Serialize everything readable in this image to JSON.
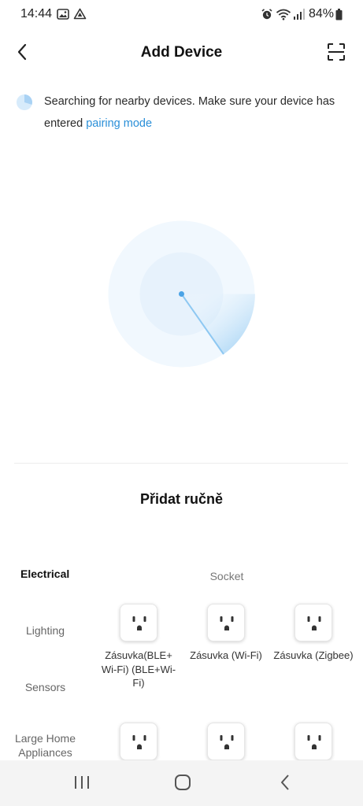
{
  "status_bar": {
    "time": "14:44",
    "battery": "84%",
    "left_icons": [
      "image-icon",
      "drive-icon"
    ],
    "right_icons": [
      "alarm-icon",
      "wifi-icon",
      "signal-icon",
      "battery-icon"
    ]
  },
  "header": {
    "title": "Add Device",
    "back_icon": "chevron-left-icon",
    "scan_icon": "scan-icon"
  },
  "search": {
    "text": "Searching for nearby devices. Make sure your device has entered ",
    "link": "pairing mode"
  },
  "manual": {
    "title": "Přidat ručně",
    "categories": [
      {
        "label": "Electrical",
        "active": true
      },
      {
        "label": "Lighting",
        "active": false
      },
      {
        "label": "Sensors",
        "active": false
      },
      {
        "label": "Large Home Appliances",
        "active": false
      }
    ],
    "section_label": "Socket",
    "devices": [
      {
        "label": "Zásuvka(BLE+ Wi-Fi) (BLE+Wi-Fi)",
        "icon": "socket-icon"
      },
      {
        "label": "Zásuvka (Wi-Fi)",
        "icon": "socket-icon"
      },
      {
        "label": "Zásuvka (Zigbee)",
        "icon": "socket-icon"
      },
      {
        "label": "",
        "icon": "socket-icon"
      },
      {
        "label": "",
        "icon": "socket-icon"
      },
      {
        "label": "",
        "icon": "socket-icon"
      }
    ]
  },
  "colors": {
    "accent": "#2a8fd8",
    "radar_light": "#eaf4fd",
    "radar_sweep": "#8ec8f2"
  },
  "nav_bar": {
    "icons": [
      "recent-apps-icon",
      "home-icon",
      "back-icon"
    ]
  }
}
